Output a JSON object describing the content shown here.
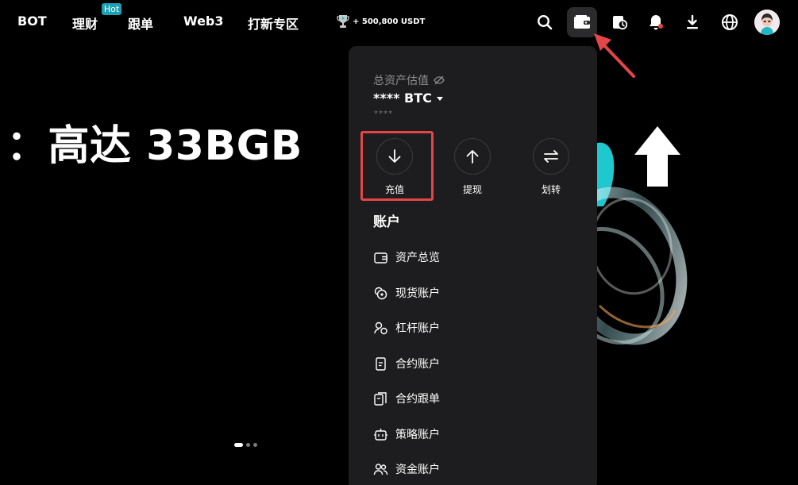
{
  "nav": {
    "items": [
      {
        "label": "BOT"
      },
      {
        "label": "理财",
        "badge": "Hot"
      },
      {
        "label": "跟单"
      },
      {
        "label": "Web3"
      },
      {
        "label": "打新专区"
      }
    ],
    "promo_text": "+ 500,800 USDT",
    "icons": [
      "search-icon",
      "wallet-icon",
      "history-icon",
      "bell-icon",
      "download-icon",
      "globe-icon",
      "avatar"
    ]
  },
  "hero": {
    "title": "：高达 33BGB",
    "carousel_count": 3,
    "carousel_active": 0
  },
  "wallet_panel": {
    "asset_label": "总资产估值",
    "asset_value": "**** BTC",
    "asset_sub": "****",
    "actions": [
      {
        "label": "充值",
        "icon": "arrow-down-icon"
      },
      {
        "label": "提现",
        "icon": "arrow-up-icon"
      },
      {
        "label": "划转",
        "icon": "transfer-icon"
      }
    ],
    "section_title": "账户",
    "menu": [
      {
        "label": "资产总览",
        "icon": "wallet-outline-icon"
      },
      {
        "label": "现货账户",
        "icon": "spot-coins-icon"
      },
      {
        "label": "杠杆账户",
        "icon": "margin-icon"
      },
      {
        "label": "合约账户",
        "icon": "futures-icon"
      },
      {
        "label": "合约跟单",
        "icon": "copy-trade-icon"
      },
      {
        "label": "策略账户",
        "icon": "bot-icon"
      },
      {
        "label": "资金账户",
        "icon": "users-icon"
      }
    ]
  },
  "colors": {
    "background": "#000000",
    "panel": "#1d1d1f",
    "hot_badge": "#1da2b4",
    "annotation_red": "#e34646",
    "accent_cyan": "#1fc7cf"
  }
}
